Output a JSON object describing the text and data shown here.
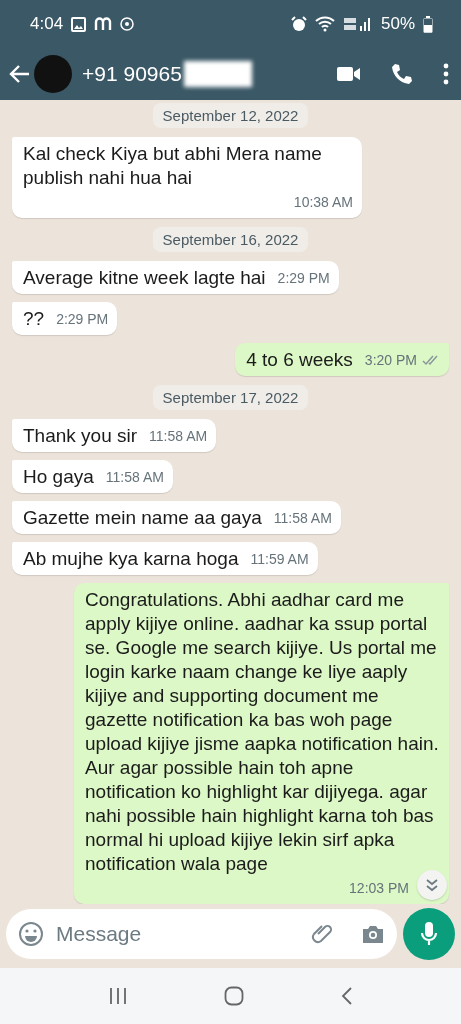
{
  "status_bar": {
    "time": "4:04",
    "battery": "50%"
  },
  "header": {
    "title": "+91 90965"
  },
  "messages": [
    {
      "kind": "date",
      "text": "September 12, 2022"
    },
    {
      "kind": "in",
      "text": "Kal check Kiya but abhi Mera name publish nahi hua hai",
      "time": "10:38 AM"
    },
    {
      "kind": "date",
      "text": "September 16, 2022"
    },
    {
      "kind": "in",
      "text": "Average kitne week lagte hai",
      "time": "2:29 PM"
    },
    {
      "kind": "in",
      "text": "??",
      "time": "2:29 PM"
    },
    {
      "kind": "out",
      "text": "4 to 6 weeks",
      "time": "3:20 PM",
      "delivered": true
    },
    {
      "kind": "date",
      "text": "September 17, 2022"
    },
    {
      "kind": "in",
      "text": "Thank you sir",
      "time": "11:58 AM"
    },
    {
      "kind": "in",
      "text": "Ho gaya",
      "time": "11:58 AM"
    },
    {
      "kind": "in",
      "text": "Gazette mein name aa gaya",
      "time": "11:58 AM"
    },
    {
      "kind": "in",
      "text": "Ab mujhe kya karna hoga",
      "time": "11:59 AM"
    },
    {
      "kind": "out",
      "text": "Congratulations. Abhi aadhar card me apply kijiye online. aadhar ka ssup portal se. Google me search kijiye. Us portal me login karke naam change ke liye aaply kijiye and supporting document me gazette notification ka bas woh page upload kijiye jisme aapka notification hain. Aur agar possible hain toh apne notification ko highlight kar dijiyega. agar nahi possible hain highlight karna toh bas normal hi upload kijiye lekin sirf apka notification wala page",
      "time": "12:03 PM"
    }
  ],
  "composer": {
    "placeholder": "Message"
  }
}
